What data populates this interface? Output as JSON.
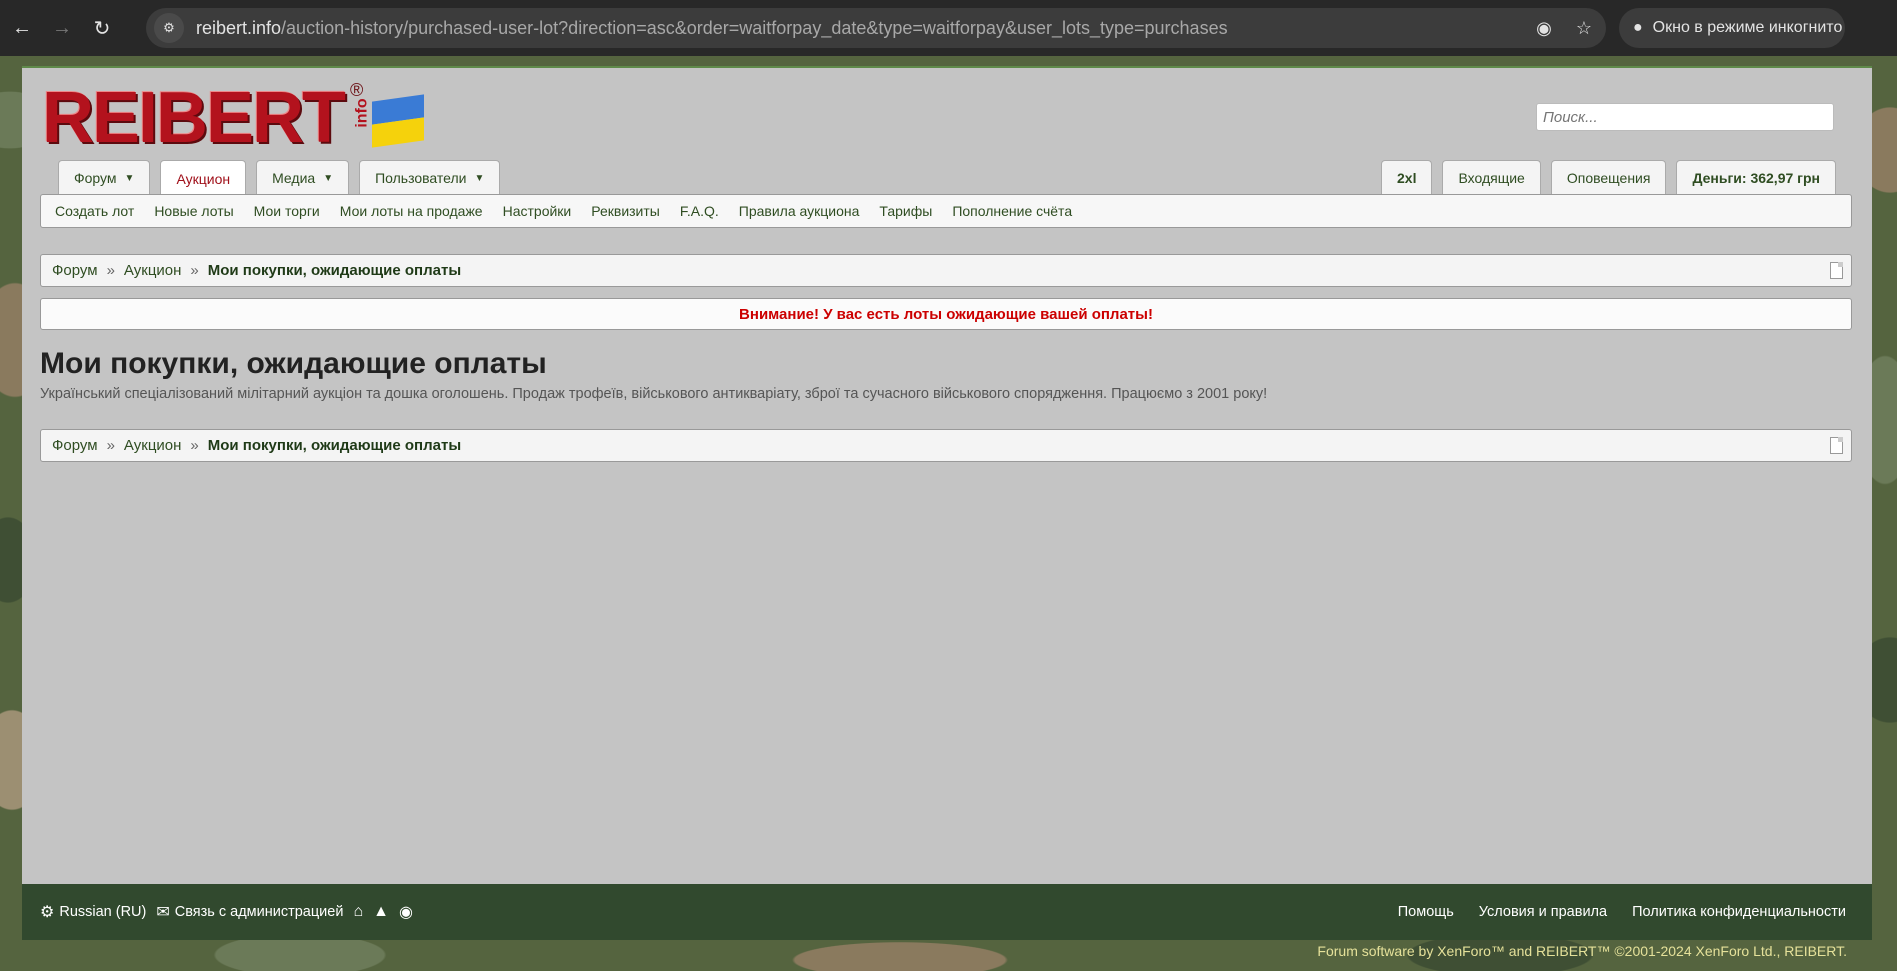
{
  "browser": {
    "url_host": "reibert.info",
    "url_path": "/auction-history/purchased-user-lot?direction=asc&order=waitforpay_date&type=waitforpay&user_lots_type=purchases",
    "incognito_label": "Окно в режиме инкогнито"
  },
  "header": {
    "logo_text": "REIBERT",
    "logo_reg": "®",
    "logo_info": "info",
    "search_placeholder": "Поиск..."
  },
  "tabs_left": [
    {
      "label": "Форум",
      "dropdown": true
    },
    {
      "label": "Аукцион",
      "active": true
    },
    {
      "label": "Медиа",
      "dropdown": true
    },
    {
      "label": "Пользователи",
      "dropdown": true
    }
  ],
  "tabs_right": [
    {
      "label": "2xl"
    },
    {
      "label": "Входящие"
    },
    {
      "label": "Оповещения"
    },
    {
      "label": "Деньги: 362,97 грн"
    }
  ],
  "subnav": [
    "Создать лот",
    "Новые лоты",
    "Мои торги",
    "Мои лоты на продаже",
    "Настройки",
    "Реквизиты",
    "F.A.Q.",
    "Правила аукциона",
    "Тарифы",
    "Пополнение счёта"
  ],
  "breadcrumb": {
    "items": [
      "Форум",
      "Аукцион"
    ],
    "separator": "»",
    "current": "Мои покупки, ожидающие оплаты"
  },
  "notice": "Внимание! У вас есть лоты ожидающие вашей оплаты!",
  "page_title": "Мои покупки, ожидающие оплаты",
  "page_description": "Український спеціалізований мілітарний аукціон та дошка оголошень. Продаж трофеїв, військового антикваріату, зброї та сучасного військового спорядження. Працюємо з 2001 року!",
  "footer": {
    "language": "Russian (RU)",
    "contact": "Связь с администрацией",
    "links": [
      "Помощь",
      "Условия и правила",
      "Политика конфиденциальности"
    ],
    "copyright": "Forum software by XenForo™ and REIBERT™ ©2001-2024 XenForo Ltd., REIBERT."
  },
  "colors": {
    "accent_green": "#2f4d22",
    "active_tab": "#a0101a",
    "notice_red": "#cc0000",
    "footer_bg": "#31492e"
  }
}
